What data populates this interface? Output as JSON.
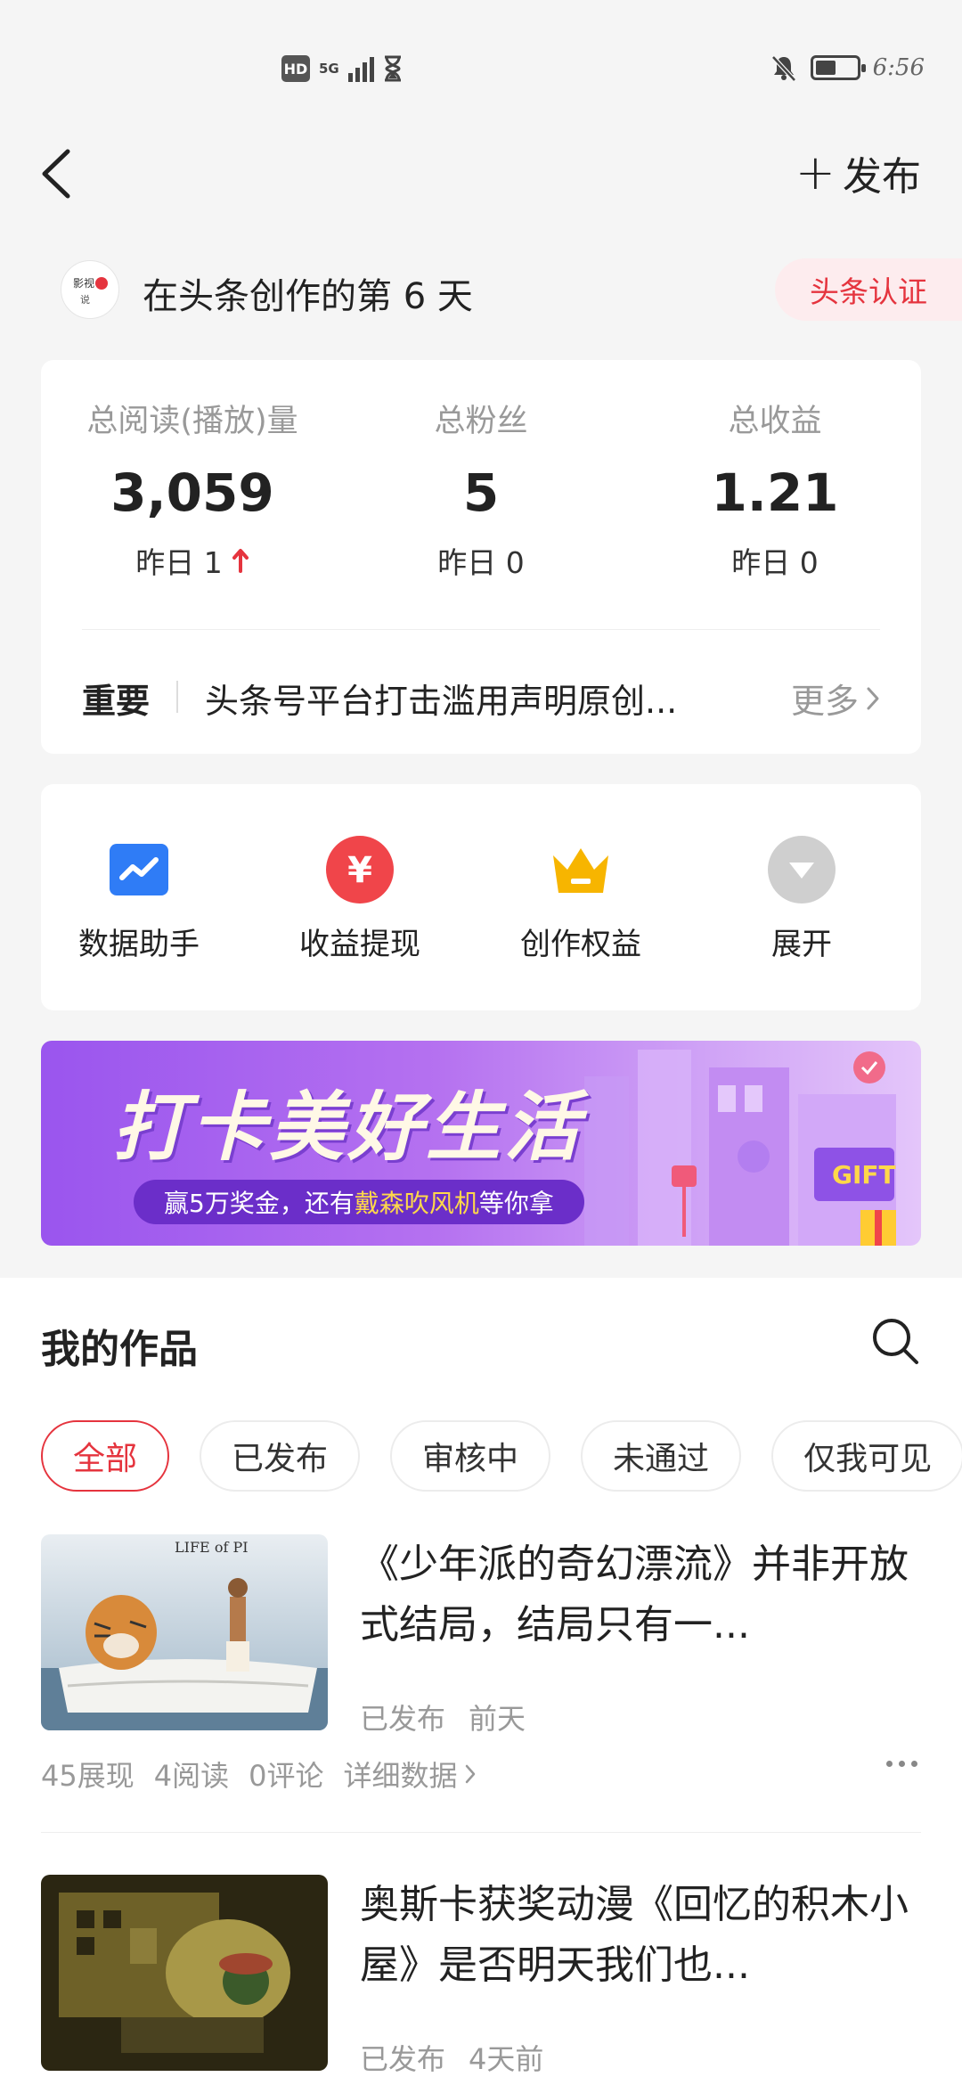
{
  "status_bar": {
    "hd": "HD",
    "network": "5G",
    "time": "6:56",
    "battery_level": 0.5
  },
  "nav": {
    "publish_label": "发布"
  },
  "creator": {
    "avatar_text": "",
    "days_text": "在头条创作的第 6 天",
    "verify_label": "头条认证"
  },
  "stats": {
    "reads": {
      "label": "总阅读(播放)量",
      "value": "3,059",
      "sub": "昨日 1"
    },
    "fans": {
      "label": "总粉丝",
      "value": "5",
      "sub": "昨日 0"
    },
    "income": {
      "label": "总收益",
      "value": "1.21",
      "sub": "昨日 0"
    }
  },
  "notice": {
    "tag": "重要",
    "text": "头条号平台打击滥用声明原创...",
    "more": "更多"
  },
  "tools": [
    {
      "label": "数据助手",
      "icon": "chart-icon",
      "color": "#2f7cf6"
    },
    {
      "label": "收益提现",
      "icon": "yuan-icon",
      "color": "#f0454a"
    },
    {
      "label": "创作权益",
      "icon": "crown-icon",
      "color": "#f7b500"
    },
    {
      "label": "展开",
      "icon": "expand-icon",
      "color": "#cfcfcf"
    }
  ],
  "banner": {
    "title": "打卡美好生活",
    "subtitle_pre": "赢5万奖金，还有",
    "subtitle_highlight": "戴森吹风机",
    "subtitle_post": "等你拿",
    "gift_text": "GIFT"
  },
  "works": {
    "title": "我的作品",
    "filters": [
      "全部",
      "已发布",
      "审核中",
      "未通过",
      "仅我可见"
    ],
    "active_filter": "全部",
    "items": [
      {
        "thumb_text": "LIFE of PI",
        "title": "《少年派的奇幻漂流》并非开放式结局，结局只有一...",
        "status": "已发布",
        "time": "前天",
        "impressions": "45展现",
        "reads": "4阅读",
        "comments": "0评论",
        "detail": "详细数据"
      },
      {
        "thumb_text": "",
        "title": "奥斯卡获奖动漫《回忆的积木小屋》是否明天我们也...",
        "status": "已发布",
        "time": "4天前"
      }
    ]
  },
  "colors": {
    "accent": "#e5343e",
    "background": "#f5f5f5"
  }
}
